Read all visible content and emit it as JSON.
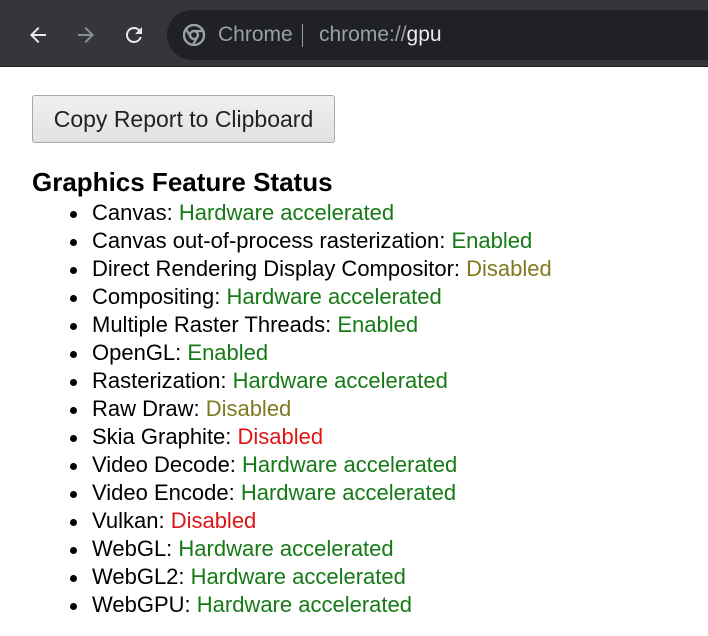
{
  "browser": {
    "scheme_label": "Chrome",
    "url_prefix": "chrome://",
    "url_host": "gpu",
    "icons": {
      "back": "arrow-left-icon",
      "forward": "arrow-right-icon",
      "reload": "reload-icon",
      "site": "chrome-logo-icon"
    }
  },
  "page": {
    "copy_button_label": "Copy Report to Clipboard",
    "section_title": "Graphics Feature Status",
    "features": [
      {
        "name": "Canvas: ",
        "status": "Hardware accelerated",
        "status_color": "#157a15"
      },
      {
        "name": "Canvas out-of-process rasterization: ",
        "status": "Enabled",
        "status_color": "#157a15"
      },
      {
        "name": "Direct Rendering Display Compositor: ",
        "status": "Disabled",
        "status_color": "#7f7a1f"
      },
      {
        "name": "Compositing: ",
        "status": "Hardware accelerated",
        "status_color": "#157a15"
      },
      {
        "name": "Multiple Raster Threads: ",
        "status": "Enabled",
        "status_color": "#157a15"
      },
      {
        "name": "OpenGL: ",
        "status": "Enabled",
        "status_color": "#157a15"
      },
      {
        "name": "Rasterization: ",
        "status": "Hardware accelerated",
        "status_color": "#157a15"
      },
      {
        "name": "Raw Draw: ",
        "status": "Disabled",
        "status_color": "#7f7a1f"
      },
      {
        "name": "Skia Graphite: ",
        "status": "Disabled",
        "status_color": "#e01414"
      },
      {
        "name": "Video Decode: ",
        "status": "Hardware accelerated",
        "status_color": "#157a15"
      },
      {
        "name": "Video Encode: ",
        "status": "Hardware accelerated",
        "status_color": "#157a15"
      },
      {
        "name": "Vulkan: ",
        "status": "Disabled",
        "status_color": "#e01414"
      },
      {
        "name": "WebGL: ",
        "status": "Hardware accelerated",
        "status_color": "#157a15"
      },
      {
        "name": "WebGL2: ",
        "status": "Hardware accelerated",
        "status_color": "#157a15"
      },
      {
        "name": "WebGPU: ",
        "status": "Hardware accelerated",
        "status_color": "#157a15"
      }
    ]
  }
}
